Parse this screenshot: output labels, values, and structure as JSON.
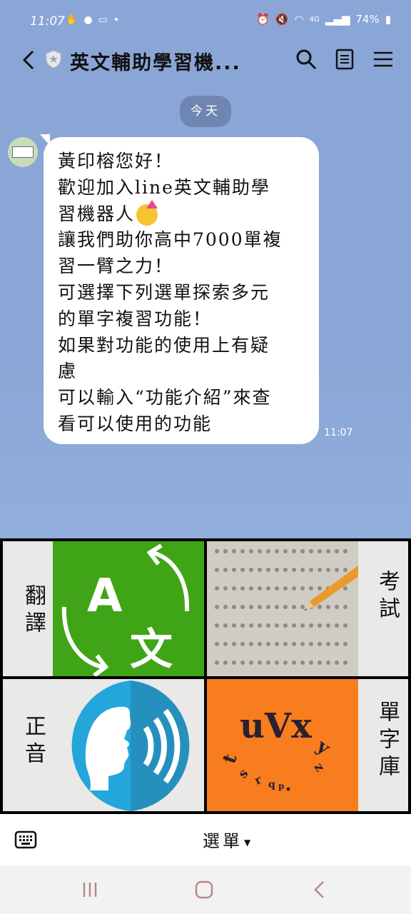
{
  "status_bar": {
    "time": "11:07",
    "network": "4G",
    "battery": "74%"
  },
  "header": {
    "title": "英文輔助學習機..."
  },
  "chat": {
    "date_chip": "今天",
    "message": {
      "lines": [
        "黃印榕您好！",
        "歡迎加入line英文輔助學",
        "習機器人",
        "讓我們助你高中7000單複",
        "習一臂之力！",
        "可選擇下列選單探索多元",
        "的單字複習功能！",
        "如果對功能的使用上有疑",
        "慮",
        "可以輸入“功能介紹”來查",
        "看可以使用的功能"
      ],
      "time": "11:07"
    }
  },
  "rich_menu": {
    "tiles": [
      {
        "label": "翻譯",
        "art_text_a": "A",
        "art_text_b": "文"
      },
      {
        "label": "考試"
      },
      {
        "label": "正音"
      },
      {
        "label": "單字庫",
        "art_text": "uVx"
      }
    ]
  },
  "menu_bar": {
    "toggle_label": "選單"
  },
  "colors": {
    "chat_bg": "#8aa6d6",
    "translate_green": "#3fa517",
    "vocab_orange": "#f77d1e",
    "speech_blue": "#2196c9"
  }
}
